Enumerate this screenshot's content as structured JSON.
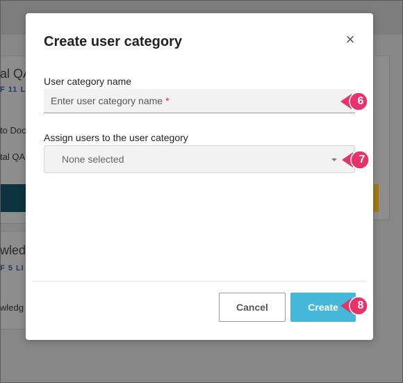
{
  "background": {
    "card1_title": "al QA",
    "card1_subtitle": "F 11 LI",
    "card1_line1": "to Doc",
    "card1_line2": "tal QA",
    "card2_title": "wledg",
    "card2_subtitle": "F 5 LI",
    "card2_line1": "wledg"
  },
  "dialog": {
    "title": "Create user category",
    "close_icon": "×",
    "name_label": "User category name",
    "name_placeholder": "Enter user category name",
    "required_mark": "*",
    "assign_label": "Assign users to the user category",
    "assign_value": "None selected",
    "cancel_label": "Cancel",
    "create_label": "Create"
  },
  "callouts": [
    {
      "number": "6"
    },
    {
      "number": "7"
    },
    {
      "number": "8"
    }
  ],
  "colors": {
    "accent": "#45b8da",
    "callout": "#e8336a",
    "required": "#e0283c"
  }
}
